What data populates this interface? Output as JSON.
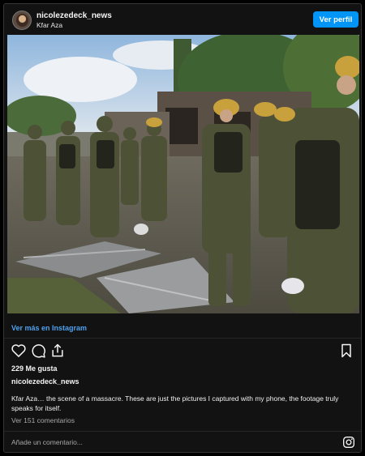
{
  "header": {
    "username": "nicolezedeck_news",
    "location": "Kfar Aza",
    "profile_button": "Ver perfil"
  },
  "post": {
    "view_more_link": "Ver más en Instagram",
    "likes": "229 Me gusta",
    "caption_username": "nicolezedeck_news",
    "caption_text": "Kfar Aza… the scene of a massacre. These are just the pictures I captured with my phone, the footage truly speaks for itself.",
    "comments_link": "Ver 151 comentarios",
    "comment_placeholder": "Añade un comentario..."
  },
  "icons": {
    "like": "heart-icon",
    "comment": "comment-icon",
    "share": "share-icon",
    "save": "bookmark-icon",
    "brand": "instagram-icon"
  },
  "colors": {
    "accent": "#0095f6",
    "link": "#4ea2ee",
    "background": "#121212"
  }
}
